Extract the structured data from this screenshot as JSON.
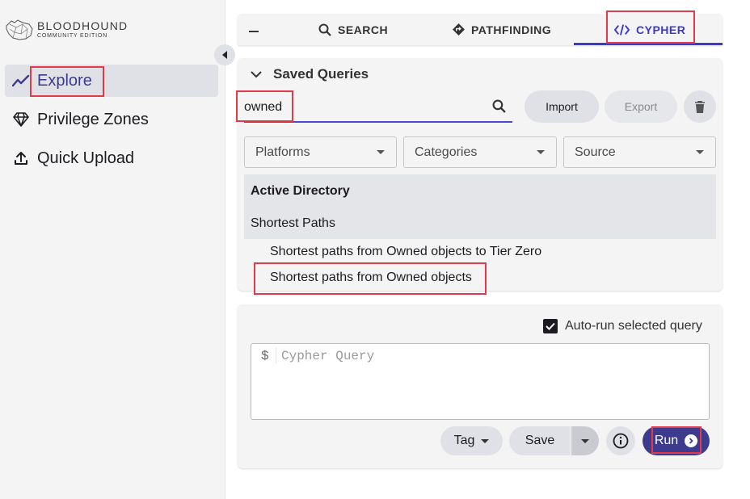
{
  "app": {
    "logo_title": "BLOODHOUND",
    "logo_subtitle": "COMMUNITY EDITION"
  },
  "sidebar": {
    "items": [
      {
        "label": "Explore",
        "icon": "explore-chart-icon",
        "active": true
      },
      {
        "label": "Privilege Zones",
        "icon": "diamond-icon",
        "active": false
      },
      {
        "label": "Quick Upload",
        "icon": "upload-icon",
        "active": false
      }
    ]
  },
  "tabs": {
    "items": [
      {
        "label": "SEARCH",
        "icon": "search-icon",
        "active": false
      },
      {
        "label": "PATHFINDING",
        "icon": "pathfinding-icon",
        "active": false
      },
      {
        "label": "CYPHER",
        "icon": "code-icon",
        "active": true
      }
    ]
  },
  "saved_queries": {
    "title": "Saved Queries",
    "search_value": "owned",
    "import_label": "Import",
    "export_label": "Export",
    "filters": [
      "Platforms",
      "Categories",
      "Source"
    ],
    "group": {
      "title": "Active Directory",
      "subgroup": "Shortest Paths",
      "items": [
        "Shortest paths from Owned objects to Tier Zero",
        "Shortest paths from Owned objects"
      ]
    }
  },
  "cypher": {
    "autorun_label": "Auto-run selected query",
    "autorun_checked": true,
    "prompt": "$",
    "placeholder": "Cypher Query",
    "tag_label": "Tag",
    "save_label": "Save",
    "run_label": "Run"
  },
  "colors": {
    "accent": "#3b3ac9",
    "run_button": "#3d3b8e",
    "highlight": "#e33a4b"
  }
}
